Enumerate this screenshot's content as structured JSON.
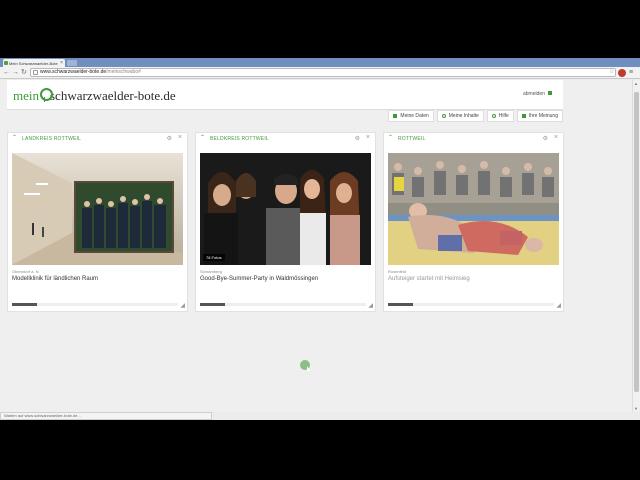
{
  "browser": {
    "tab_title": "Mein Schwarzwaelder-Bote",
    "url_host": "www.schwarzwaelder-bote.de",
    "url_path": "/meinschwabo#",
    "status_text": "Warten auf www.schwarzwaelder-bote.de..."
  },
  "site": {
    "logo_mein": "mein",
    "logo_site": "schwarzwaelder-bote.de",
    "logout_label": "abmelden",
    "accent_color": "#3f9a3a"
  },
  "nav": {
    "items": [
      {
        "label": "Meine Daten",
        "icon": "grid-icon"
      },
      {
        "label": "Meine Inhalte",
        "icon": "speech-bubble-icon"
      },
      {
        "label": "Hilfe",
        "icon": "help-icon"
      },
      {
        "label": "Ihre Meinung",
        "icon": "comment-icon"
      }
    ]
  },
  "cards": [
    {
      "title": "LANDKREIS ROTTWEIL",
      "place": "Oberndorf a. N.",
      "headline": "Modellklinik für ländlichen Raum",
      "photo_badge": "",
      "progress": 0.15
    },
    {
      "title": "BELDKREIS ROTTWEIL",
      "place": "Schramberg",
      "headline": "Good-Bye-Summer-Party in Waldmössingen",
      "photo_badge": "78 Fotos",
      "progress": 0.15
    },
    {
      "title": "ROTTWEIL",
      "place": "Rosenfeld",
      "headline": "Aufsteiger startet mit Heimsieg",
      "photo_badge": "",
      "progress": 0.15
    }
  ]
}
